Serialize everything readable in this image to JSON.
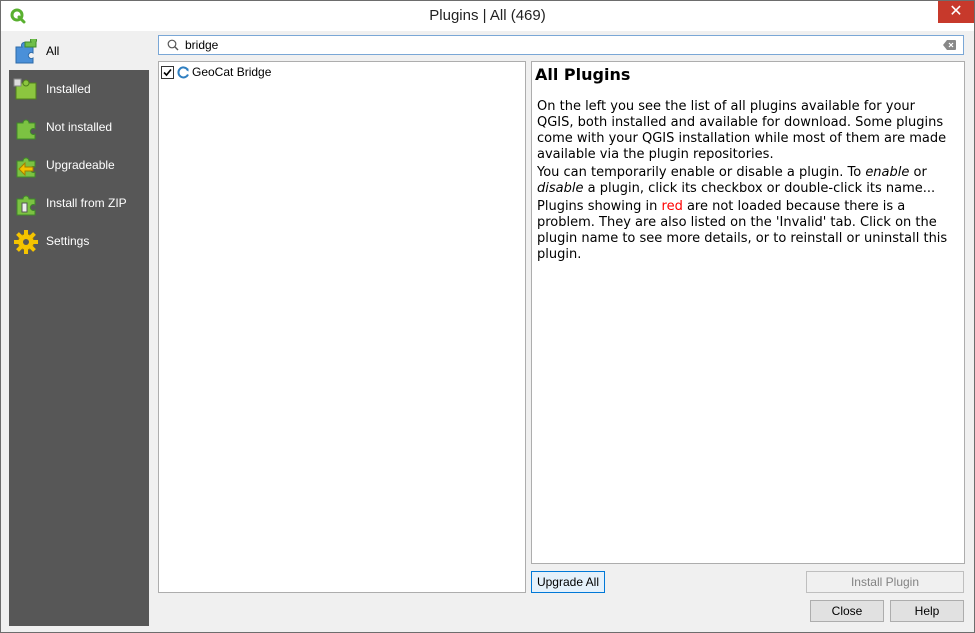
{
  "window": {
    "title": "Plugins | All (469)",
    "close_glyph": "✕"
  },
  "sidebar": {
    "items": [
      {
        "label": "All",
        "icon": "puzzle-all-icon",
        "active": true
      },
      {
        "label": "Installed",
        "icon": "puzzle-installed-icon"
      },
      {
        "label": "Not installed",
        "icon": "puzzle-not-installed-icon"
      },
      {
        "label": "Upgradeable",
        "icon": "puzzle-upgradeable-icon"
      },
      {
        "label": "Install from ZIP",
        "icon": "puzzle-zip-icon"
      },
      {
        "label": "Settings",
        "icon": "gear-icon"
      }
    ]
  },
  "search": {
    "value": "bridge"
  },
  "plugin_list": {
    "items": [
      {
        "name": "GeoCat Bridge",
        "checked": true
      }
    ]
  },
  "details": {
    "heading": "All Plugins",
    "para1": "On the left you see the list of all plugins available for your QGIS, both installed and available for download. Some plugins come with your QGIS installation while most of them are made available via the plugin repositories.",
    "para2_a": "You can temporarily enable or disable a plugin. To ",
    "para2_enable": "enable",
    "para2_b": " or ",
    "para2_disable": "disable",
    "para2_c": " a plugin, click its checkbox or double-click its name...",
    "para3_a": "Plugins showing in ",
    "para3_red": "red",
    "para3_b": " are not loaded because there is a problem. They are also listed on the 'Invalid' tab. Click on the plugin name to see more details, or to reinstall or uninstall this plugin."
  },
  "buttons": {
    "upgrade_all": "Upgrade All",
    "install_plugin": "Install Plugin",
    "close": "Close",
    "help": "Help"
  },
  "colors": {
    "accent": "#0078d7",
    "sidebar_bg": "#575757",
    "red_text": "#ff0000"
  }
}
